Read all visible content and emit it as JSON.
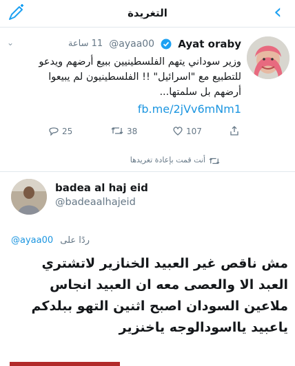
{
  "header": {
    "title": "التغريدة",
    "back_icon": "chevron-left-icon",
    "compose_icon": "compose-icon"
  },
  "quoted_tweet": {
    "author_name": "Ayat oraby",
    "handle": "@ayaa00",
    "time": "11 ساعة",
    "text": "وزير سوداني يتهم الفلسطينيين ببيع أرضهم ويدعو للتطبيع مع \"اسرائيل\" !! الفلسطينيون لم يبيعوا أرضهم بل سلمتها...",
    "link": "fb.me/2jVv6mNm1",
    "replies": "25",
    "retweets": "38",
    "likes": "107"
  },
  "retweet_note": "أنت قمت بإعادة تغريدها",
  "main_tweet": {
    "author_name": "badea al haj eid",
    "handle": "@badeaalhajeid",
    "reply_label": "ردًا على",
    "reply_to": "@ayaa00",
    "text": "مش ناقص غير العبيد الخنازير لاتشتري العبد الا والعصى معه ان العبيد انجاس ملاعين السودان اصبح اثنين التهو ببلدكم ياعبيد يااسودالوجه ياخنزير"
  },
  "colors": {
    "accent": "#1da1f2",
    "link": "#1b95e0",
    "muted": "#657786",
    "text": "#14171a"
  }
}
